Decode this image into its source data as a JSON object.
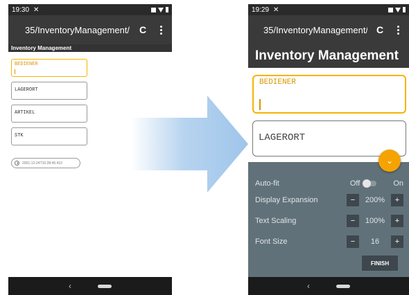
{
  "left_phone": {
    "status_time": "19:30",
    "url": "35/InventoryManagement/",
    "page_title": "Inventory Management",
    "fields": [
      "BEDIENER",
      "LAGERORT",
      "ARTIKEL",
      "STK"
    ],
    "timestamp": "2001-12-24T10:28:45.410"
  },
  "right_phone": {
    "status_time": "19:29",
    "url": "35/InventoryManagement/",
    "page_title": "Inventory Management",
    "fields": [
      "BEDIENER",
      "LAGERORT"
    ],
    "settings": {
      "autofit_label": "Auto-fit",
      "autofit_off": "Off",
      "autofit_on": "On",
      "display_expansion_label": "Display Expansion",
      "display_expansion_value": "200%",
      "text_scaling_label": "Text Scaling",
      "text_scaling_value": "100%",
      "font_size_label": "Font Size",
      "font_size_value": "16",
      "finish_label": "FINISH"
    }
  },
  "icons": {
    "tool": "tools-icon",
    "refresh": "refresh-icon",
    "menu": "more-vert-icon",
    "fab": "chevron-down-icon"
  },
  "colors": {
    "accent": "#f5b400",
    "panel": "#61717a",
    "appbar": "#3a3a3a",
    "arrow": "#9fc5ea"
  }
}
